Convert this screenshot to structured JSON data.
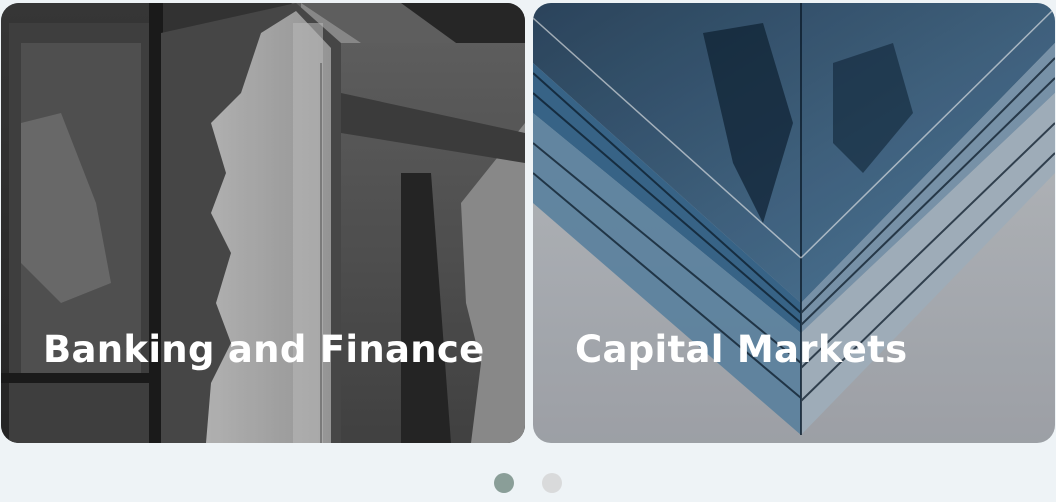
{
  "carousel": {
    "slides": [
      {
        "title": "Banking and Finance",
        "image": "office-building-facade-bw"
      },
      {
        "title": "Capital Markets",
        "image": "glass-skyscraper-corner-blue"
      }
    ],
    "pagination": {
      "active_index": 0,
      "active_color": "#8a9e98",
      "inactive_color": "#d9dadb"
    }
  }
}
